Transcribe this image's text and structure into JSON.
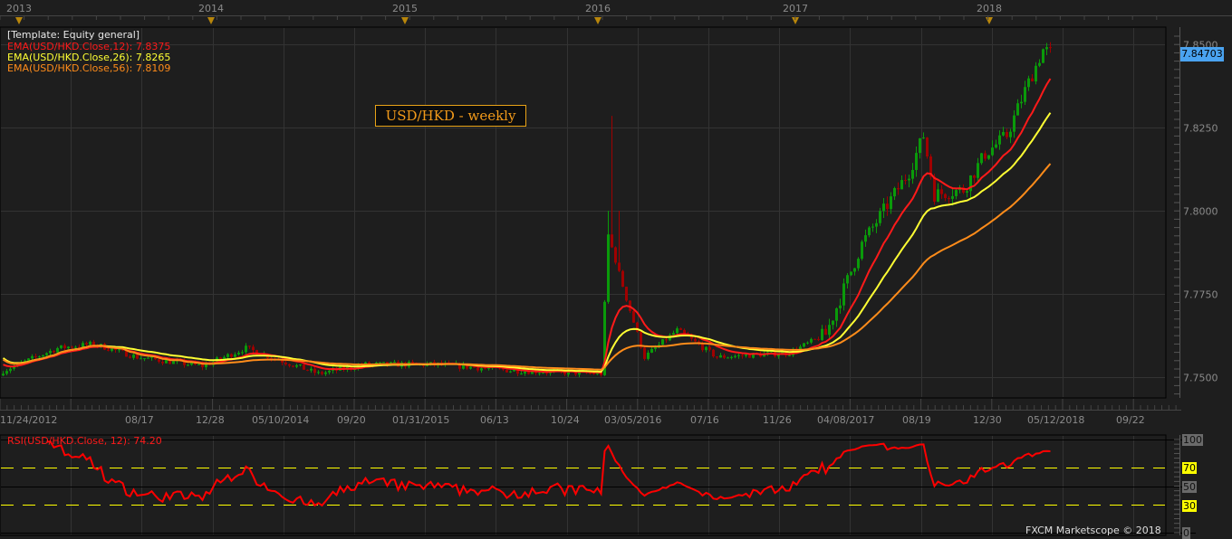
{
  "chart_data": {
    "type": "candlestick",
    "title": "USD/HKD - weekly",
    "template_label": "[Template: Equity general]",
    "years": [
      "2013",
      "2014",
      "2015",
      "2016",
      "2017",
      "2018"
    ],
    "date_labels": [
      "11/24/2012",
      "08/17",
      "12/28",
      "05/10/2014",
      "09/20",
      "01/31/2015",
      "06/13",
      "10/24",
      "03/05/2016",
      "07/16",
      "11/26",
      "04/08/2017",
      "08/19",
      "12/30",
      "05/12/2018",
      "09/22"
    ],
    "price_ticks": [
      "7.7500",
      "7.7750",
      "7.8000",
      "7.8250",
      "7.8500"
    ],
    "ylim": [
      7.7465,
      7.8535
    ],
    "current_price": "7.84703",
    "weeks": 290,
    "close_control": [
      [
        0,
        7.7519
      ],
      [
        15,
        7.7587
      ],
      [
        25,
        7.76
      ],
      [
        37,
        7.756
      ],
      [
        55,
        7.7533
      ],
      [
        67,
        7.7587
      ],
      [
        87,
        7.751
      ],
      [
        100,
        7.7538
      ],
      [
        120,
        7.7538
      ],
      [
        140,
        7.752
      ],
      [
        165,
        7.751
      ],
      [
        167,
        7.7927
      ],
      [
        172,
        7.7736
      ],
      [
        177,
        7.756
      ],
      [
        186,
        7.7641
      ],
      [
        197,
        7.756
      ],
      [
        217,
        7.7573
      ],
      [
        227,
        7.7628
      ],
      [
        237,
        7.79
      ],
      [
        250,
        7.8117
      ],
      [
        254,
        7.8226
      ],
      [
        257,
        7.8049
      ],
      [
        265,
        7.8063
      ],
      [
        271,
        7.8171
      ],
      [
        277,
        7.8226
      ],
      [
        282,
        7.8361
      ],
      [
        287,
        7.8484
      ],
      [
        289,
        7.8475
      ]
    ],
    "spikes": [
      [
        168,
        7.8285
      ],
      [
        167,
        7.8
      ],
      [
        170,
        7.8
      ]
    ],
    "indicators": [
      {
        "label": "EMA(USD/HKD.Close,12)",
        "value": "7.8375",
        "period": 12,
        "color": "#ff1a1a"
      },
      {
        "label": "EMA(USD/HKD.Close,26)",
        "value": "7.8265",
        "period": 26,
        "color": "#ffff33"
      },
      {
        "label": "EMA(USD/HKD.Close,56)",
        "value": "7.8109",
        "period": 56,
        "color": "#ff8c1a"
      }
    ],
    "rsi": {
      "label": "RSI(USD/HKD.Close, 12)",
      "value": "74.20",
      "period": 12,
      "levels": [
        70,
        30
      ],
      "ticks": [
        "100",
        "70",
        "50",
        "30",
        "0"
      ],
      "color": "#ff0000"
    },
    "colors": {
      "up": "#0a9a0a",
      "down": "#a00000"
    }
  },
  "footer": {
    "copyright": "FXCM Marketscope © 2018"
  }
}
